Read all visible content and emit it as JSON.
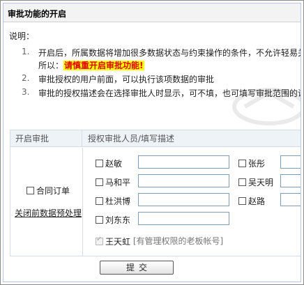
{
  "window": {
    "title": "审批功能的开启"
  },
  "description": {
    "heading": "说明：",
    "items": [
      {
        "num": "1.",
        "line1": "开启后，所属数据将增加很多数据状态与约束操作的条件，不允许轻易关",
        "line2_prefix": "所以：",
        "warning": "请慎重开启审批功能!"
      },
      {
        "num": "2.",
        "text": "审批授权的用户前面，可以执行该项数据的审批"
      },
      {
        "num": "3.",
        "text": "审批的授权描述会在选择审批人时显示，可不填，也可填写审批范围的说"
      }
    ]
  },
  "table": {
    "col1_header": "开启审批",
    "col2_header": "授权审批人员/填写描述",
    "left": {
      "checkbox_label": "合同订单",
      "link": "关闭前数据预处理"
    },
    "approvers": [
      {
        "name": "赵敏",
        "checked": false
      },
      {
        "name": "张彤",
        "checked": false
      },
      {
        "name": "马和平",
        "checked": false
      },
      {
        "name": "吴天明",
        "checked": false
      },
      {
        "name": "杜洪博",
        "checked": false
      },
      {
        "name": "赵路",
        "checked": false
      },
      {
        "name": "刘东东",
        "checked": false
      }
    ],
    "admin": {
      "name": "王天虹",
      "note": "[有管理权限的老板帐号]",
      "checked": true,
      "disabled": true
    }
  },
  "submit_label": "提交"
}
